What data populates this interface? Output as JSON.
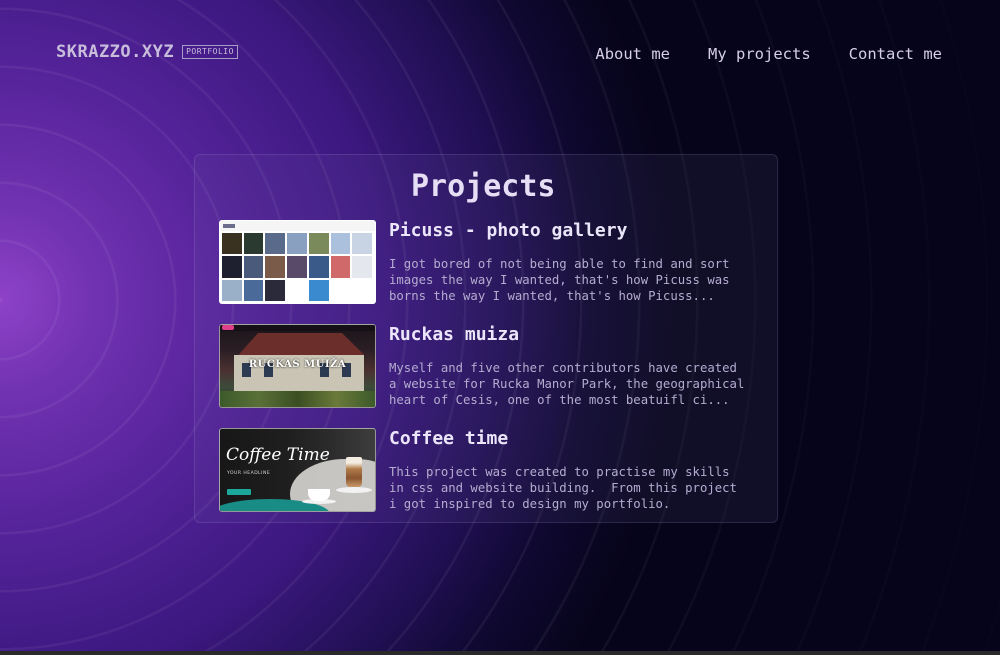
{
  "site": {
    "logo": "SKRAZZO.XYZ",
    "badge": "PORTFOLIO"
  },
  "nav": [
    {
      "label": "About me"
    },
    {
      "label": "My projects"
    },
    {
      "label": "Contact me"
    }
  ],
  "projects_section": {
    "title": "Projects",
    "items": [
      {
        "title": "Picuss - photo gallery",
        "description": "I got bored of not being able to find and sort\nimages the way I wanted, that's how Picuss was\nborns the way I wanted, that's how Picuss...",
        "thumbnail_icon": "photo-gallery-screenshot"
      },
      {
        "title": "Ruckas muiza",
        "description": "Myself and five other contributors have created\na website for Rucka Manor Park, the geographical\nheart of Cesis, one of the most beatuifl ci...",
        "thumbnail_icon": "manor-website-screenshot",
        "thumbnail_text": "RUCKAS MUIŽA"
      },
      {
        "title": "Coffee time",
        "description": "This project was created to practise my skills\nin css and website building.  From this project\ni got inspired to design my portfolio.",
        "thumbnail_icon": "coffee-website-screenshot",
        "thumbnail_text": "Coffee Time",
        "thumbnail_subtext": "YOUR HEADLINE"
      }
    ]
  },
  "colors": {
    "accent_purple": "#8e42c8",
    "background": "#06041a",
    "text": "#e4dcf4",
    "muted_text": "#b5acd0"
  }
}
